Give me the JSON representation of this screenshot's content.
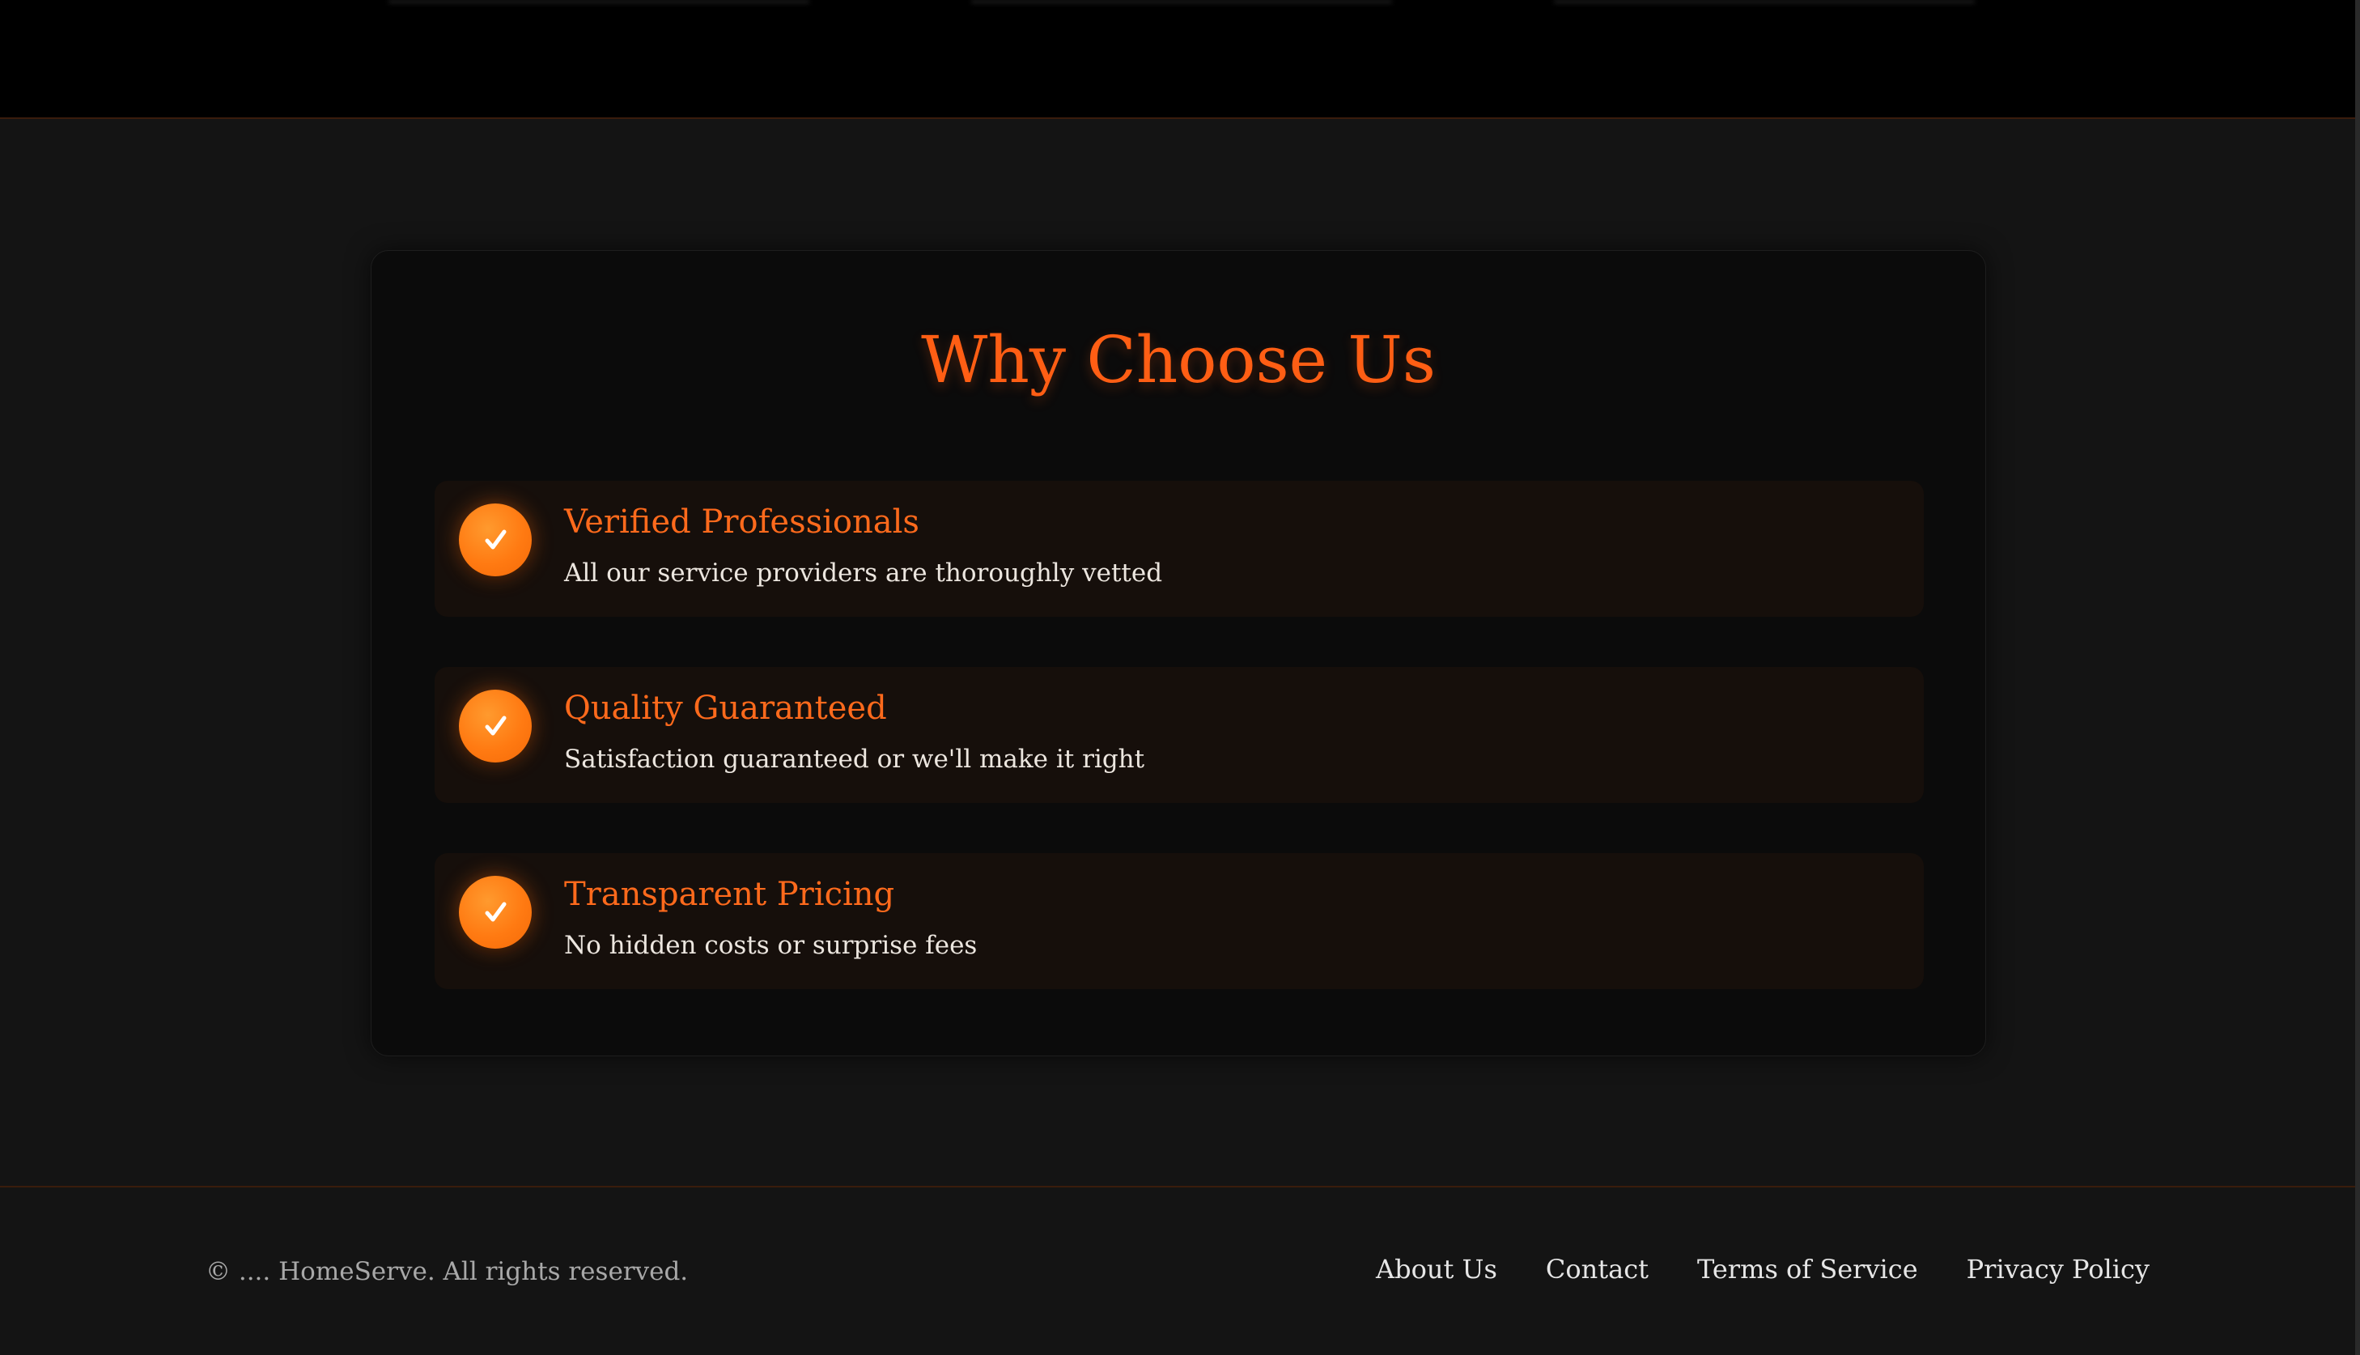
{
  "section": {
    "title": "Why Choose Us",
    "features": [
      {
        "title": "Verified Professionals",
        "description": "All our service providers are thoroughly vetted",
        "icon": "check-icon"
      },
      {
        "title": "Quality Guaranteed",
        "description": "Satisfaction guaranteed or we'll make it right",
        "icon": "check-icon"
      },
      {
        "title": "Transparent Pricing",
        "description": "No hidden costs or surprise fees",
        "icon": "check-icon"
      }
    ]
  },
  "footer": {
    "copyright": "© .... HomeServe. All rights reserved.",
    "links": [
      "About Us",
      "Contact",
      "Terms of Service",
      "Privacy Policy"
    ]
  },
  "colors": {
    "accent": "#ff6a1c",
    "background": "#141414",
    "card": "#0b0b0b",
    "feature_bg": "#160f0b"
  }
}
